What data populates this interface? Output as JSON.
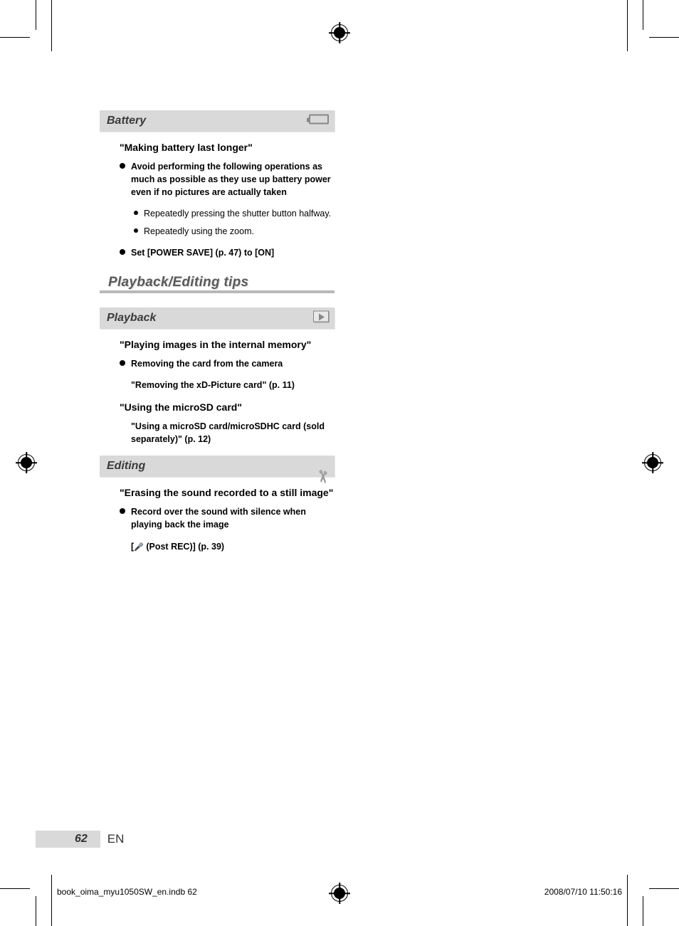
{
  "sections": {
    "battery": {
      "title": "Battery",
      "tip1_heading": "\"Making battery last longer\"",
      "bullet1": "Avoid performing the following operations as much as possible as they use up battery power even if no pictures are actually taken",
      "sub1": "Repeatedly pressing the shutter button halfway.",
      "sub2": "Repeatedly using the zoom.",
      "bullet2": "Set [POWER SAVE] (p. 47) to [ON]"
    },
    "major_heading": "Playback/Editing tips",
    "playback": {
      "title": "Playback",
      "tip1_heading": "\"Playing images in the internal memory\"",
      "bullet1": "Removing the card from the camera",
      "ref1": "\"Removing the xD-Picture card\" (p. 11)",
      "tip2_heading": "\"Using the microSD card\"",
      "ref2": "\"Using a microSD card/microSDHC card (sold separately)\" (p. 12)"
    },
    "editing": {
      "title": "Editing",
      "tip1_heading": "\"Erasing the sound recorded to a still image\"",
      "bullet1": "Record over the sound with silence when playing back the image",
      "ref1_prefix": "[",
      "ref1_suffix": " (Post REC)] (p. 39)"
    }
  },
  "footer": {
    "page_number": "62",
    "lang": "EN",
    "imprint_file": "book_oima_myu1050SW_en.indb   62",
    "imprint_date": "2008/07/10   11:50:16"
  }
}
